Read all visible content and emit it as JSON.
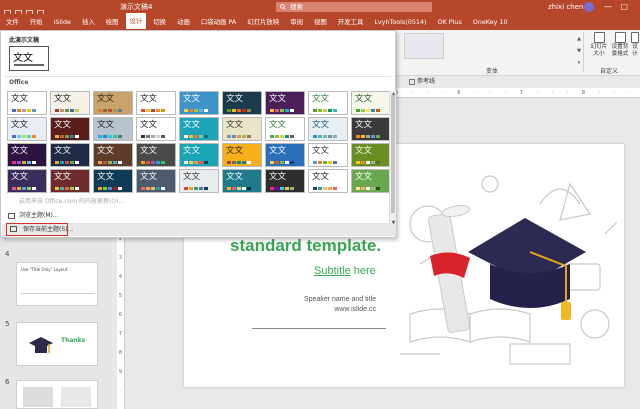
{
  "window": {
    "document_title": "演示文稿4",
    "search_placeholder": "搜索",
    "user_name": "zhixi chen",
    "controls": "—  ▢  ✕"
  },
  "tabs": [
    "文件",
    "开始",
    "iSlide",
    "插入",
    "绘图",
    "设计",
    "切换",
    "动画",
    "口袋动画 PA",
    "幻灯片放映",
    "审阅",
    "视图",
    "开发工具",
    "LvyhTools(0514)",
    "OK Plus",
    "OneKey 10"
  ],
  "active_tab": "设计",
  "ribbon": {
    "variants_label": "变体",
    "customize_label": "自定义",
    "btn_slide_size": "幻灯片\n大小",
    "btn_format_bg": "设置背\n景格式",
    "btn_design": "设\n计"
  },
  "view_toolbar": {
    "guides_label": "参考线"
  },
  "ruler_ticks": "5 · · · 6 · · · 7 · · · 8 · · · 9 · · · 10 · · · 11 · · · 12 · · · 13 · · · 14 · · · 15 · · · 16",
  "vruler_ticks": [
    "2",
    "3",
    "4",
    "5",
    "6",
    "7",
    "8",
    "9",
    "·"
  ],
  "dropdown": {
    "this_presentation_label": "此演示文稿",
    "current_theme_text": "文文",
    "office_label": "Office",
    "menu": {
      "online_search": "启用来自 Office.com 的内容更新(O)...",
      "browse_themes": "浏览主题(M)...",
      "save_theme": "保存当前主题(S)..."
    }
  },
  "themes": [
    {
      "text": "文文",
      "bg": "#ffffff",
      "fg": "#222",
      "sw": [
        "#4472c4",
        "#ed7d31",
        "#a5a5a5",
        "#ffc000",
        "#5b9bd5"
      ]
    },
    {
      "text": "文文",
      "bg": "#f4f1e8",
      "fg": "#222",
      "sw": [
        "#9e3e2c",
        "#c3986b",
        "#6b8e4e",
        "#4b6a8c",
        "#d4c94a"
      ]
    },
    {
      "text": "文文",
      "bg": "#c8a36b",
      "fg": "#2a1d0e",
      "sw": [
        "#e07b28",
        "#8c6c3b",
        "#c24b32",
        "#a6a04a",
        "#5c7a9c"
      ]
    },
    {
      "text": "文文",
      "bg": "#ffffff",
      "fg": "#222",
      "sw": [
        "#e84c22",
        "#ffbd47",
        "#b64926",
        "#ff8427",
        "#cc9900"
      ]
    },
    {
      "text": "文文",
      "bg": "#3d94c9",
      "fg": "#fff",
      "sw": [
        "#f0d34f",
        "#e97c30",
        "#a5c249",
        "#6bb5e3",
        "#ffffff"
      ]
    },
    {
      "text": "文文",
      "bg": "#1b3a4b",
      "fg": "#fff",
      "sw": [
        "#54a021",
        "#e6b91e",
        "#e76618",
        "#c42f1a",
        "#918655"
      ]
    },
    {
      "text": "文文",
      "bg": "#4c1e5a",
      "fg": "#fff",
      "sw": [
        "#f9c02d",
        "#e04f8e",
        "#8cc63f",
        "#29a9e1",
        "#ffffff"
      ]
    },
    {
      "text": "文文",
      "bg": "#ffffff",
      "fg": "#2e7d32",
      "sw": [
        "#549e39",
        "#8ab833",
        "#c0cf3a",
        "#029676",
        "#4ab5c4"
      ]
    },
    {
      "text": "文文",
      "bg": "#f5f7ea",
      "fg": "#1b5e20",
      "sw": [
        "#4aa033",
        "#93c95b",
        "#fee04e",
        "#2e86c1",
        "#d35400"
      ]
    },
    {
      "text": "文文",
      "bg": "#e8eef6",
      "fg": "#222",
      "sw": [
        "#4e67c8",
        "#5eccf3",
        "#a7ea52",
        "#5dceaf",
        "#ff8021"
      ]
    },
    {
      "text": "文文",
      "bg": "#5a1f1a",
      "fg": "#fff",
      "sw": [
        "#e8b54d",
        "#c45e3a",
        "#7d9e4a",
        "#3b7d9c",
        "#ffffff"
      ]
    },
    {
      "text": "文文",
      "bg": "#b7c4cf",
      "fg": "#222",
      "sw": [
        "#1cade4",
        "#2683c6",
        "#27ced7",
        "#42ba97",
        "#3e8853"
      ]
    },
    {
      "text": "文文",
      "bg": "#ffffff",
      "fg": "#222",
      "sw": [
        "#333333",
        "#777777",
        "#aaaaaa",
        "#d0d0d0",
        "#555555"
      ]
    },
    {
      "text": "文文",
      "bg": "#1fa3b9",
      "fg": "#fff",
      "sw": [
        "#ffffff",
        "#f3c14a",
        "#e57a3c",
        "#76c6a0",
        "#0e6e80"
      ]
    },
    {
      "text": "文文",
      "bg": "#e9e3c7",
      "fg": "#333",
      "sw": [
        "#7f8fa9",
        "#5b8fc9",
        "#e4934b",
        "#b7b24e",
        "#8a7a64"
      ]
    },
    {
      "text": "文文",
      "bg": "#ffffff",
      "fg": "#2e7d32",
      "sw": [
        "#4caf50",
        "#8bc34a",
        "#cddc39",
        "#009688",
        "#795548"
      ]
    },
    {
      "text": "文文",
      "bg": "#e6f0f4",
      "fg": "#1a5a6b",
      "sw": [
        "#3494ba",
        "#58b6c0",
        "#75bda7",
        "#7a8c8e",
        "#84acb6"
      ]
    },
    {
      "text": "文文",
      "bg": "#3a3a3a",
      "fg": "#fff",
      "sw": [
        "#ff8021",
        "#ffc000",
        "#a5a5a5",
        "#5b9bd5",
        "#70ad47"
      ]
    },
    {
      "text": "文文",
      "bg": "#2d1440",
      "fg": "#fff",
      "sw": [
        "#e62e8c",
        "#9b4ddb",
        "#f0a030",
        "#4ecbe1",
        "#ffffff"
      ]
    },
    {
      "text": "文文",
      "bg": "#1f2a44",
      "fg": "#fff",
      "sw": [
        "#e6b21b",
        "#1b9fd3",
        "#e2493a",
        "#52b351",
        "#ffffff"
      ]
    },
    {
      "text": "文文",
      "bg": "#5d3c2a",
      "fg": "#fff",
      "sw": [
        "#f0a24e",
        "#c0504d",
        "#9bbb59",
        "#4bacc6",
        "#ffffff"
      ]
    },
    {
      "text": "文文",
      "bg": "#4a4a4a",
      "fg": "#fff",
      "sw": [
        "#f39c12",
        "#e74c3c",
        "#9b59b6",
        "#3498db",
        "#2ecc71"
      ]
    },
    {
      "text": "文文",
      "bg": "#19a5b3",
      "fg": "#fff",
      "sw": [
        "#ffffff",
        "#f4d35e",
        "#ee964b",
        "#f95738",
        "#0d3b66"
      ]
    },
    {
      "text": "文文",
      "bg": "#f6b11a",
      "fg": "#222",
      "sw": [
        "#b03a2e",
        "#5d6d7e",
        "#1e8449",
        "#2874a6",
        "#ffffff"
      ]
    },
    {
      "text": "文文",
      "bg": "#2a6fb8",
      "fg": "#fff",
      "sw": [
        "#f8d347",
        "#e05a2b",
        "#6cc04a",
        "#ffffff",
        "#0b3d91"
      ]
    },
    {
      "text": "文文",
      "bg": "#ffffff",
      "fg": "#333",
      "sw": [
        "#5b9bd5",
        "#ed7d31",
        "#70ad47",
        "#ffc000",
        "#4472c4"
      ]
    },
    {
      "text": "文文",
      "bg": "#6b8e23",
      "fg": "#fff",
      "sw": [
        "#ffd700",
        "#ff8c00",
        "#ffffff",
        "#8fbc8f",
        "#556b2f"
      ]
    },
    {
      "text": "文文",
      "bg": "#3b2c5e",
      "fg": "#fff",
      "sw": [
        "#d95c8e",
        "#f2b134",
        "#59a5d8",
        "#8fd16a",
        "#ffffff"
      ]
    },
    {
      "text": "文文",
      "bg": "#6e2c2c",
      "fg": "#fff",
      "sw": [
        "#f0c419",
        "#3ab0c9",
        "#e66c2c",
        "#9ccc65",
        "#ffffff"
      ]
    },
    {
      "text": "文文",
      "bg": "#0f3b57",
      "fg": "#fff",
      "sw": [
        "#f5a623",
        "#7ed321",
        "#4a90e2",
        "#d0021b",
        "#ffffff"
      ]
    },
    {
      "text": "文文",
      "bg": "#4e5b6e",
      "fg": "#fff",
      "sw": [
        "#e76f51",
        "#f4a261",
        "#e9c46a",
        "#2a9d8f",
        "#ffffff"
      ]
    },
    {
      "text": "文文",
      "bg": "#e9ecef",
      "fg": "#333",
      "sw": [
        "#e63946",
        "#f1a208",
        "#2a9d8f",
        "#457b9d",
        "#1d3557"
      ]
    },
    {
      "text": "文文",
      "bg": "#1f7a8c",
      "fg": "#fff",
      "sw": [
        "#f7b32b",
        "#e85d75",
        "#c3e88d",
        "#ffffff",
        "#022b3a"
      ]
    },
    {
      "text": "文文",
      "bg": "#2e2e2e",
      "fg": "#fff",
      "sw": [
        "#f72585",
        "#7209b7",
        "#4cc9f0",
        "#f9c74f",
        "#90be6d"
      ]
    },
    {
      "text": "文文",
      "bg": "#ffffff",
      "fg": "#222",
      "sw": [
        "#264653",
        "#2a9d8f",
        "#e9c46a",
        "#f4a261",
        "#e76f51"
      ]
    },
    {
      "text": "文文",
      "bg": "#6aa84f",
      "fg": "#fff",
      "sw": [
        "#ffe599",
        "#f6b26b",
        "#ffffff",
        "#93c47d",
        "#274e13"
      ]
    }
  ],
  "slide": {
    "title": "standard template.",
    "subtitle_word": "Subtitle",
    "subtitle_rest": " here",
    "speaker": "Speaker name and title",
    "website": "www.islide.cc"
  },
  "thumbnails": [
    {
      "num": "4",
      "caption": "Use \"Title Only\" Layout"
    },
    {
      "num": "5",
      "caption": "Thanks"
    },
    {
      "num": "6",
      "caption": ""
    }
  ]
}
